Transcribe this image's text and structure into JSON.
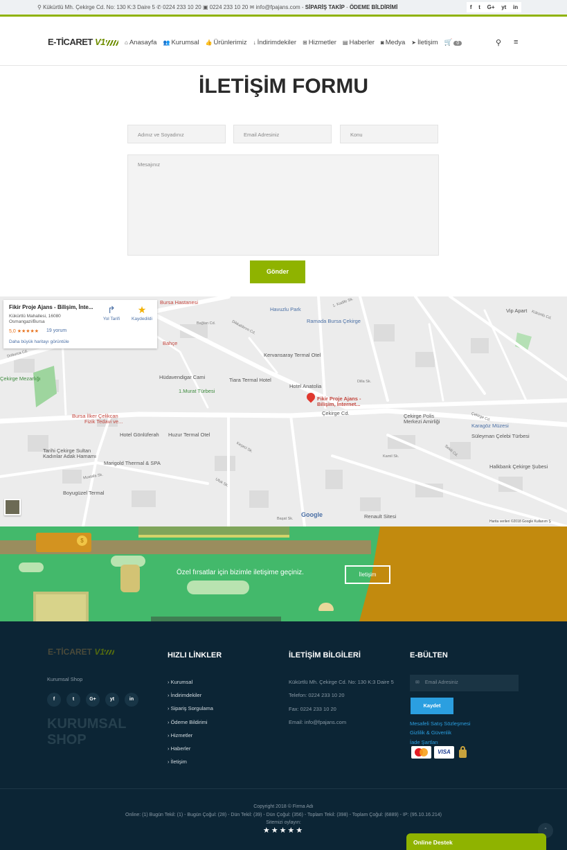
{
  "topbar": {
    "address": "Kükürtlü Mh. Çekirge Cd. No: 130 K:3 Daire 5",
    "phone": "0224 233 10 20",
    "fax": "0224 233 10 20",
    "email": "info@fpajans.com",
    "order_track": "SİPARİŞ TAKİP",
    "payment_notice": "ÖDEME BİLDİRİMİ",
    "social": [
      "f",
      "t",
      "G+",
      "yt",
      "in"
    ]
  },
  "header": {
    "logo_text": "E-TİCARET",
    "logo_v1": "V1",
    "nav": [
      {
        "icon": "home-icon",
        "glyph": "⌂",
        "label": "Anasayfa"
      },
      {
        "icon": "users-icon",
        "glyph": "👥",
        "label": "Kurumsal"
      },
      {
        "icon": "thumbs-up-icon",
        "glyph": "👍",
        "label": "Ürünlerimiz"
      },
      {
        "icon": "arrow-down-icon",
        "glyph": "↓",
        "label": "İndirimdekiler"
      },
      {
        "icon": "plus-square-icon",
        "glyph": "⊞",
        "label": "Hizmetler"
      },
      {
        "icon": "newspaper-icon",
        "glyph": "▤",
        "label": "Haberler"
      },
      {
        "icon": "camera-icon",
        "glyph": "◙",
        "label": "Medya"
      },
      {
        "icon": "paper-plane-icon",
        "glyph": "➤",
        "label": "İletişim"
      }
    ],
    "cart_count": "0"
  },
  "form": {
    "title": "İLETİŞİM FORMU",
    "name_placeholder": "Adınız ve Soyadınız",
    "email_placeholder": "Email Adresiniz",
    "subject_placeholder": "Konu",
    "message_placeholder": "Mesajınız",
    "submit_label": "Gönder"
  },
  "map": {
    "place_name": "Fikir Proje Ajans - Bilişim, İnte...",
    "address_line1": "Kükürtlü Mahallesi, 16080",
    "address_line2": "Osmangazi/Bursa",
    "rating": "5,0",
    "stars": "★★★★★",
    "reviews": "19 yorum",
    "bigger_map": "Daha büyük haritayı görüntüle",
    "directions": "Yol Tarifi",
    "saved": "Kaydedildi",
    "pin_label_1": "Fikir Proje Ajans -",
    "pin_label_2": "Bilişim, İnternet...",
    "attribution": "Harita verileri ©2018 Google  Kullanım Ş",
    "google": "Google",
    "labels": [
      "Havuzlu Park",
      "Ramada Bursa Çekirge",
      "Vip Apart",
      "Kervansaray Termal Otel",
      "Hüdavendigar Cami",
      "Tiara Termal Hotel",
      "Hotel Anatolia",
      "1.Murat Türbesi",
      "Çekirge Mezarlığı",
      "Bursa İlker Çelikcan",
      "Fizik Tedavi ve...",
      "Hotel Gönlüferah",
      "Huzur Termal Otel",
      "Çekirge Polis",
      "Merkezi Amirliği",
      "Karagöz Müzesi",
      "Süleyman Çelebi Türbesi",
      "Tarihi Çekirge Sultan",
      "Kadınlar Adak Hamamı",
      "Marigold Thermal & SPA",
      "Boyugüzel Termal",
      "Halkbank Çekirge Şubesi",
      "Renault Sitesi",
      "Bursa Hastanesi",
      "Bahçe",
      "Çekirge Cd."
    ],
    "streets": [
      "Dikkaldırım Cd.",
      "Bağlan Cd.",
      "Doburca Cd.",
      "1. Kadife Sk.",
      "Kükürtlü Cd.",
      "Kamil Sk.",
      "Sekili Cd.",
      "Keçeci Sk.",
      "Ufuk Sk.",
      "Başat Sk.",
      "Mustafa Sk.",
      "Çekirge Cd.",
      "Dilla Sk."
    ]
  },
  "banner": {
    "message": "Özel fırsatlar için bizimle iletişime geçiniz.",
    "button": "İletişim"
  },
  "footer": {
    "tagline": "Kurumsal Shop",
    "big_text": "KURUMSAL SHOP",
    "social": [
      "f",
      "t",
      "G+",
      "yt",
      "in"
    ],
    "quick_links_title": "HIZLI LİNKLER",
    "quick_links": [
      "Kurumsal",
      "İndirimdekiler",
      "Sipariş Sorgulama",
      "Ödeme Bildirimi",
      "Hizmetler",
      "Haberler",
      "İletişim"
    ],
    "contact_title": "İLETİŞİM BİLGİLERİ",
    "contact": [
      "Kükürtlü Mh. Çekirge Cd. No: 130 K:3 Daire 5",
      "Telefon: 0224 233 10 20",
      "Fax: 0224 233 10 20",
      "Email: info@fpajans.com"
    ],
    "newsletter_title": "E-BÜLTEN",
    "newsletter_placeholder": "Email Adresiniz",
    "save_button": "Kaydet",
    "legal_links": [
      "Mesafeli Satış Sözleşmesi",
      "Gizlilik & Güvenlik",
      "İade Şartları"
    ],
    "visa": "VISA",
    "copyright": "Copyright 2018 © Firma Adı",
    "stats": "Online: (1)  Bugün Tekil: (1) -  Bugün Çoğul: (28) - Dün Tekil: (39) -  Dün Çoğul: (356) -  Toplam Tekil: (398) -  Toplam Çoğul: (6889) -  IP: (95.10.16.214)",
    "rate_site": "Sitemizi oylayın:",
    "rating_stars": "★★★★★",
    "online_support": "Online Destek"
  },
  "colors": {
    "accent": "#8fb300",
    "footer_bg": "#0c2535",
    "link_blue": "#2b9fe0"
  }
}
